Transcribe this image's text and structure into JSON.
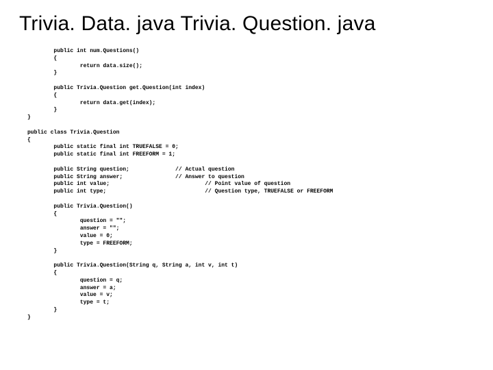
{
  "title": "Trivia. Data. java  Trivia. Question. java",
  "code": "        public int num.Questions()\n        {\n                return data.size();\n        }\n\n        public Trivia.Question get.Question(int index)\n        {\n                return data.get(index);\n        }\n}\n\npublic class Trivia.Question\n{\n        public static final int TRUEFALSE = 0;\n        public static final int FREEFORM = 1;\n\n        public String question;              // Actual question\n        public String answer;                // Answer to question\n        public int value;                             // Point value of question\n        public int type;                              // Question type, TRUEFALSE or FREEFORM\n\n        public Trivia.Question()\n        {\n                question = \"\";\n                answer = \"\";\n                value = 0;\n                type = FREEFORM;\n        }\n\n        public Trivia.Question(String q, String a, int v, int t)\n        {\n                question = q;\n                answer = a;\n                value = v;\n                type = t;\n        }\n}"
}
